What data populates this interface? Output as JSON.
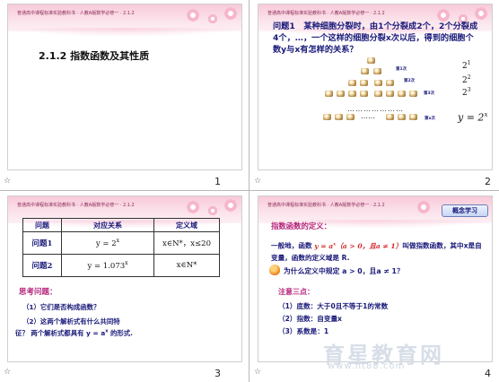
{
  "slides": [
    {
      "number": "1",
      "banner": "普通高中课程标准实验教科书 · 人教A版数学必修一 · 2.1.2",
      "title": "2.1.2    指数函数及其性质"
    },
    {
      "number": "2",
      "banner": "普通高中课程标准实验教科书 · 人教A版数学必修一 · 2.1.2",
      "question_label": "问题1",
      "question_text": "某种细胞分裂时，由1个分裂成2个，2个分裂成4个，…，一个这样的细胞分裂x次以后，得到的细胞个数y与x有怎样的关系？",
      "powers": [
        "2",
        "2",
        "2"
      ],
      "exponents": [
        "1",
        "2",
        "3"
      ],
      "row_labels": [
        "第1次",
        "第2次",
        "第3次",
        "第x次"
      ],
      "dots": "…………………",
      "ellipsis": "……",
      "formula_base": "y = 2",
      "formula_exp": "x"
    },
    {
      "number": "3",
      "banner": "普通高中课程标准实验教科书 · 人教A版数学必修一 · 2.1.2",
      "table": {
        "headers": [
          "问题",
          "对应关系",
          "定义域"
        ],
        "rows": [
          {
            "label": "问题1",
            "relation": "y = 2",
            "rel_exp": "x",
            "domain": "x∈N*，x≤20"
          },
          {
            "label": "问题2",
            "relation": "y = 1.073",
            "rel_exp": "x",
            "domain": "x∈N*"
          }
        ]
      },
      "think_title": "思考问题：",
      "think_lines": [
        "（1）它们是否构成函数？",
        "（2）这两个解析式有什么共同特",
        "征？ 两个解析式都具有 y = a",
        "x",
        " 的形式."
      ]
    },
    {
      "number": "4",
      "banner": "普通高中课程标准实验教科书 · 人教A版数学必修一 · 2.1.2",
      "button": "概念学习",
      "def_title": "指数函数的定义：",
      "def_text_1": "一般地，函数 ",
      "def_formula": "y = a",
      "def_formula_exp": "x",
      "def_cond": "（a > 0，且a ≠ 1）",
      "def_text_2": "叫做指数函数，其中x是自变量，函数的定义域是 R.",
      "why": "为什么定义中规定 a > 0，且a ≠ 1？",
      "note_title": "注意三点：",
      "points": [
        "（1）底数：大于0且不等于1的常数",
        "（2）指数：自变量x",
        "（3）系数是：1"
      ],
      "watermark": "育星教育网",
      "watermark_url": "www.ht88.com"
    }
  ],
  "colors": {
    "banner_pink": "#f8c9d9",
    "text_navy": "#1a1a7a",
    "accent_magenta": "#b4237a",
    "formula_red": "#d42a2a"
  }
}
